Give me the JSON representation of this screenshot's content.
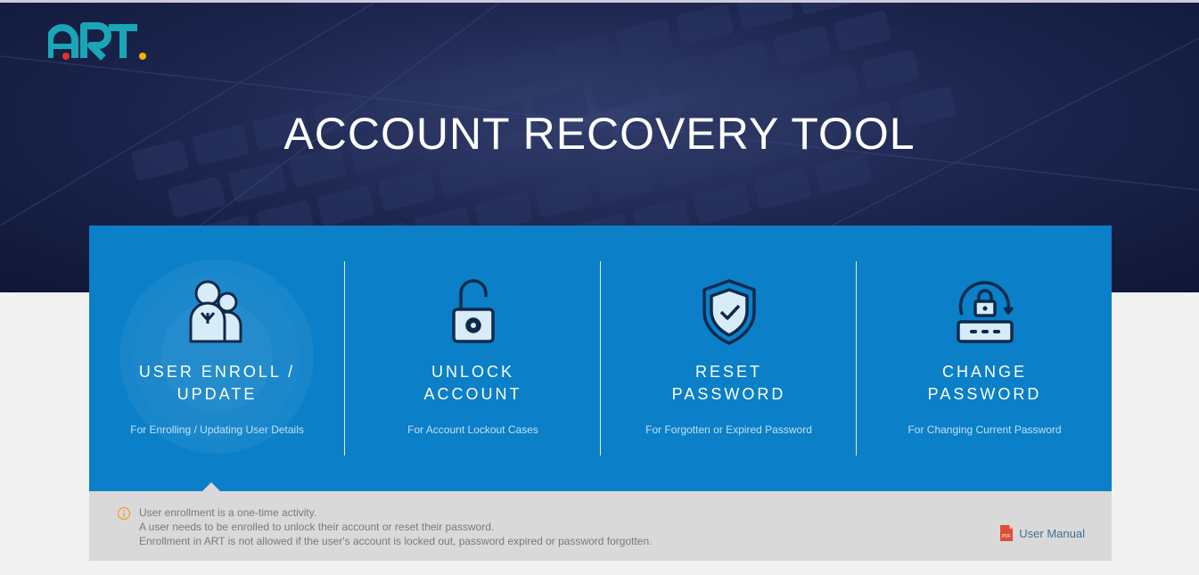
{
  "app": {
    "logo_text": "ART",
    "title": "ACCOUNT RECOVERY TOOL"
  },
  "cards": [
    {
      "line1": "USER ENROLL /",
      "line2": "UPDATE",
      "subtitle": "For Enrolling / Updating User Details",
      "icon": "users-icon"
    },
    {
      "line1": "UNLOCK",
      "line2": "ACCOUNT",
      "subtitle": "For Account Lockout Cases",
      "icon": "unlock-padlock-icon"
    },
    {
      "line1": "RESET",
      "line2": "PASSWORD",
      "subtitle": "For Forgotten or Expired Password",
      "icon": "shield-check-icon"
    },
    {
      "line1": "CHANGE",
      "line2": "PASSWORD",
      "subtitle": "For Changing Current Password",
      "icon": "password-change-icon"
    }
  ],
  "info": {
    "icon": "info-icon",
    "lines": [
      "User enrollment is a one-time activity.",
      "A user needs to be enrolled to unlock their account or reset their password.",
      "Enrollment in ART is not allowed if the user's account is locked out, password expired or password forgotten."
    ],
    "manual_label": "User Manual",
    "manual_icon": "pdf-icon",
    "pdf_badge": "PDF"
  },
  "colors": {
    "panel": "#0b7fc7",
    "hero_dark": "#0f1636",
    "info_bar": "#d9d9d9",
    "logo_teal": "#1aa6b7",
    "logo_red": "#e4322b",
    "logo_yellow": "#f5b400"
  }
}
